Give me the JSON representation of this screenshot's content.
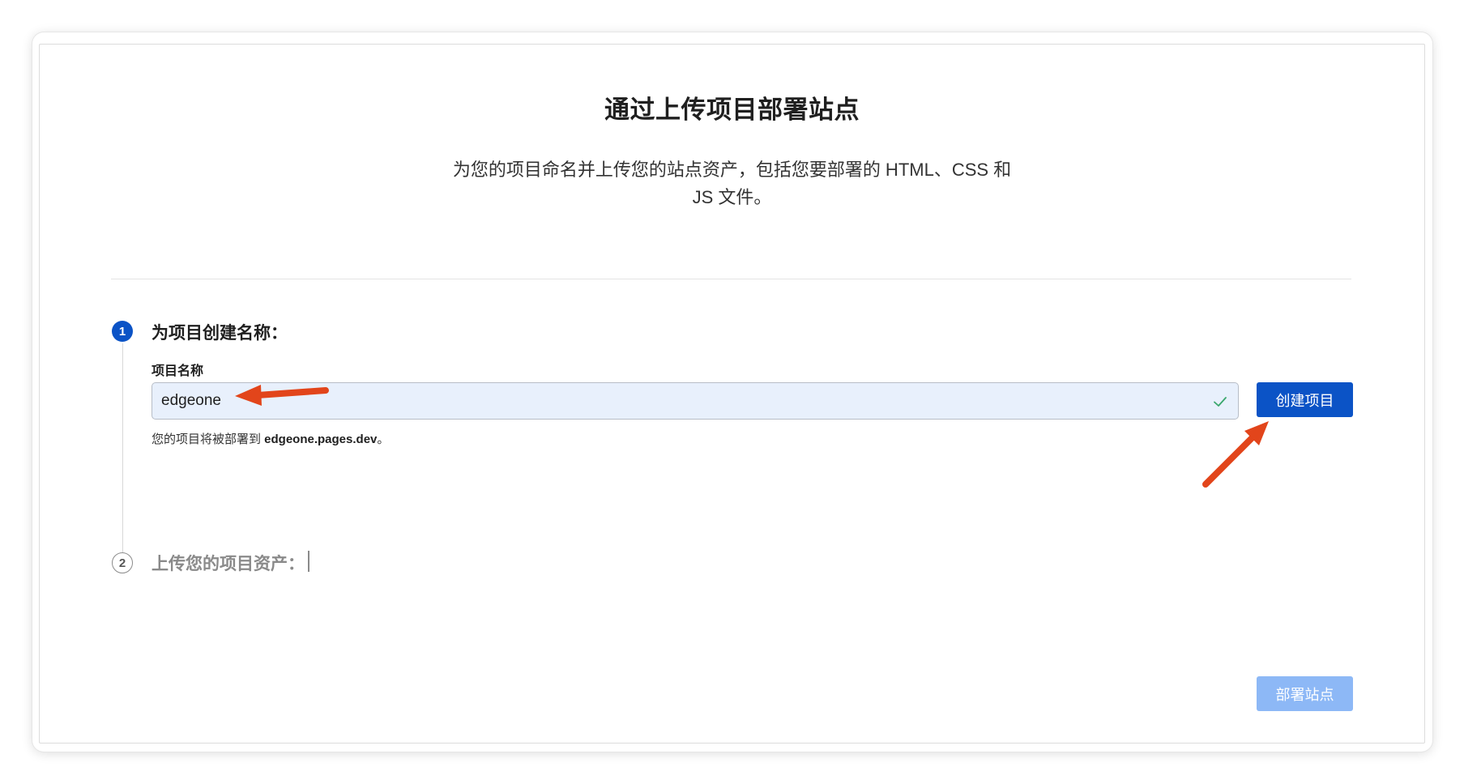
{
  "header": {
    "title": "通过上传项目部署站点",
    "subtitle": "为您的项目命名并上传您的站点资产，包括您要部署的 HTML、CSS 和 JS 文件。"
  },
  "step1": {
    "number": "1",
    "title": "为项目创建名称：",
    "field_label": "项目名称",
    "input_value": "edgeone",
    "hint_prefix": "您的项目将被部署到 ",
    "hint_domain": "edgeone.pages.dev",
    "hint_suffix": "。",
    "create_button": "创建项目"
  },
  "step2": {
    "number": "2",
    "title": "上传您的项目资产："
  },
  "footer": {
    "deploy_button": "部署站点"
  },
  "colors": {
    "primary": "#0b53c6",
    "primary_disabled": "#8db8f6",
    "input_bg": "#e8f0fc",
    "valid_check": "#3aa76d",
    "annotation_arrow": "#e2451b"
  },
  "icons": {
    "input_status": "check-icon"
  }
}
